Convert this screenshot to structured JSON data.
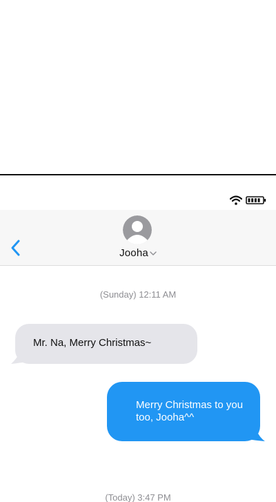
{
  "header": {
    "contact_name": "Jooha"
  },
  "icons": {
    "back": "chevron-left-icon",
    "avatar": "person-avatar-icon",
    "name_dropdown": "chevron-down-icon",
    "wifi": "wifi-icon",
    "battery": "battery-icon"
  },
  "colors": {
    "accent": "#2196f3",
    "incoming_bubble": "#e5e5ea",
    "timestamp": "#8e8e93"
  },
  "conversation": {
    "timestamp_1": "(Sunday) 12:11 AM",
    "messages": [
      {
        "direction": "incoming",
        "text": "Mr. Na, Merry Christmas~"
      },
      {
        "direction": "outgoing",
        "text": "Merry Christmas to you too, Jooha^^"
      }
    ],
    "timestamp_2": "(Today) 3:47 PM"
  }
}
